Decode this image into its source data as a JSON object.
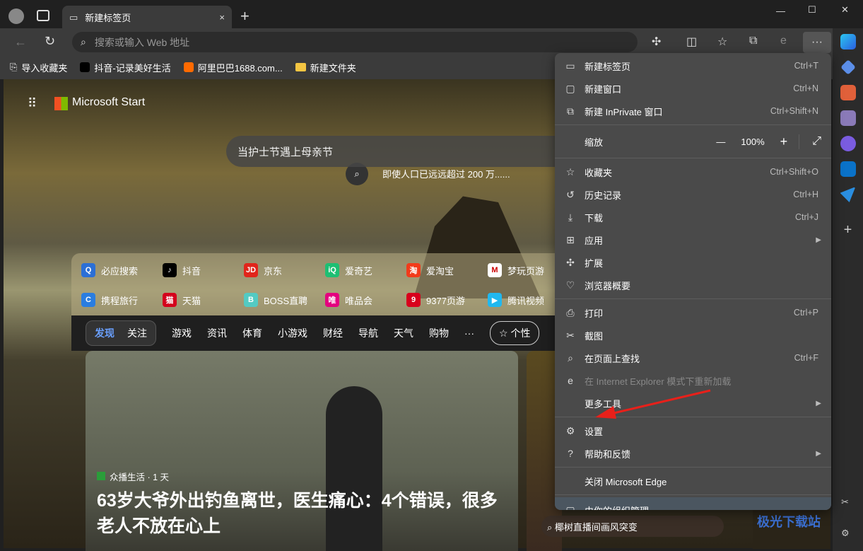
{
  "tab": {
    "title": "新建标签页",
    "close": "×",
    "new": "+"
  },
  "window": {
    "min": "—",
    "max": "☐",
    "close": "✕"
  },
  "address": {
    "placeholder": "搜索或输入 Web 地址"
  },
  "bookmarks": [
    "导入收藏夹",
    "抖音-记录美好生活",
    "阿里巴巴1688.com...",
    "新建文件夹"
  ],
  "page": {
    "brand": "Microsoft Start",
    "search": "当护士节遇上母亲节",
    "hint": "即使人口已远远超过 200 万......",
    "quick": [
      {
        "label": "必应搜索",
        "color": "#2b6fd6",
        "g": "Q"
      },
      {
        "label": "抖音",
        "color": "#000",
        "g": "♪"
      },
      {
        "label": "京东",
        "color": "#e1251b",
        "g": "JD"
      },
      {
        "label": "爱奇艺",
        "color": "#1dbf73",
        "g": "iQ"
      },
      {
        "label": "爱淘宝",
        "color": "#f23b1b",
        "g": "淘"
      },
      {
        "label": "梦玩页游",
        "color": "#fff",
        "g": "M"
      },
      {
        "label": "携程旅行",
        "color": "#2a7de1",
        "g": "C"
      },
      {
        "label": "天猫",
        "color": "#d4001c",
        "g": "猫"
      },
      {
        "label": "BOSS直聘",
        "color": "#53cac3",
        "g": "B"
      },
      {
        "label": "唯品会",
        "color": "#e4007f",
        "g": "唯"
      },
      {
        "label": "9377页游",
        "color": "#d8001c",
        "g": "9"
      },
      {
        "label": "腾讯视频",
        "color": "#20b8f0",
        "g": "▶"
      }
    ],
    "nav_pill": [
      "发现",
      "关注"
    ],
    "nav": [
      "游戏",
      "资讯",
      "体育",
      "小游戏",
      "财经",
      "导航",
      "天气",
      "购物",
      "···"
    ],
    "personalize": "个性",
    "news": {
      "source": "众播生活 · 1 天",
      "headline": "63岁大爷外出钓鱼离世，医生痛心：4个错误，很多老人不放在心上"
    },
    "side_search": "椰树直播间画风突变",
    "watermark": "极光下载站"
  },
  "menu": {
    "items": [
      {
        "label": "新建标签页",
        "shortcut": "Ctrl+T",
        "icon": "▭"
      },
      {
        "label": "新建窗口",
        "shortcut": "Ctrl+N",
        "icon": "▢"
      },
      {
        "label": "新建 InPrivate 窗口",
        "shortcut": "Ctrl+Shift+N",
        "icon": "⧉"
      },
      {
        "label": "缩放",
        "zoom": "100%",
        "minus": "—",
        "plus": "+",
        "full": "⤢"
      },
      {
        "label": "收藏夹",
        "shortcut": "Ctrl+Shift+O",
        "icon": "☆"
      },
      {
        "label": "历史记录",
        "shortcut": "Ctrl+H",
        "icon": "↺"
      },
      {
        "label": "下载",
        "shortcut": "Ctrl+J",
        "icon": "⤓"
      },
      {
        "label": "应用",
        "icon": "⊞",
        "sub": "▶"
      },
      {
        "label": "扩展",
        "icon": "✣"
      },
      {
        "label": "浏览器概要",
        "icon": "♡"
      },
      {
        "label": "打印",
        "shortcut": "Ctrl+P",
        "icon": "⎙"
      },
      {
        "label": "截图",
        "icon": "✂"
      },
      {
        "label": "在页面上查找",
        "shortcut": "Ctrl+F",
        "icon": "⌕"
      },
      {
        "label": "在 Internet Explorer 模式下重新加载",
        "icon": "e"
      },
      {
        "label": "更多工具",
        "sub": "▶"
      },
      {
        "label": "设置",
        "icon": "⚙"
      },
      {
        "label": "帮助和反馈",
        "icon": "?",
        "sub": "▶"
      },
      {
        "label": "关闭 Microsoft Edge"
      },
      {
        "label": "由你的组织管理",
        "icon": "▢"
      }
    ]
  }
}
